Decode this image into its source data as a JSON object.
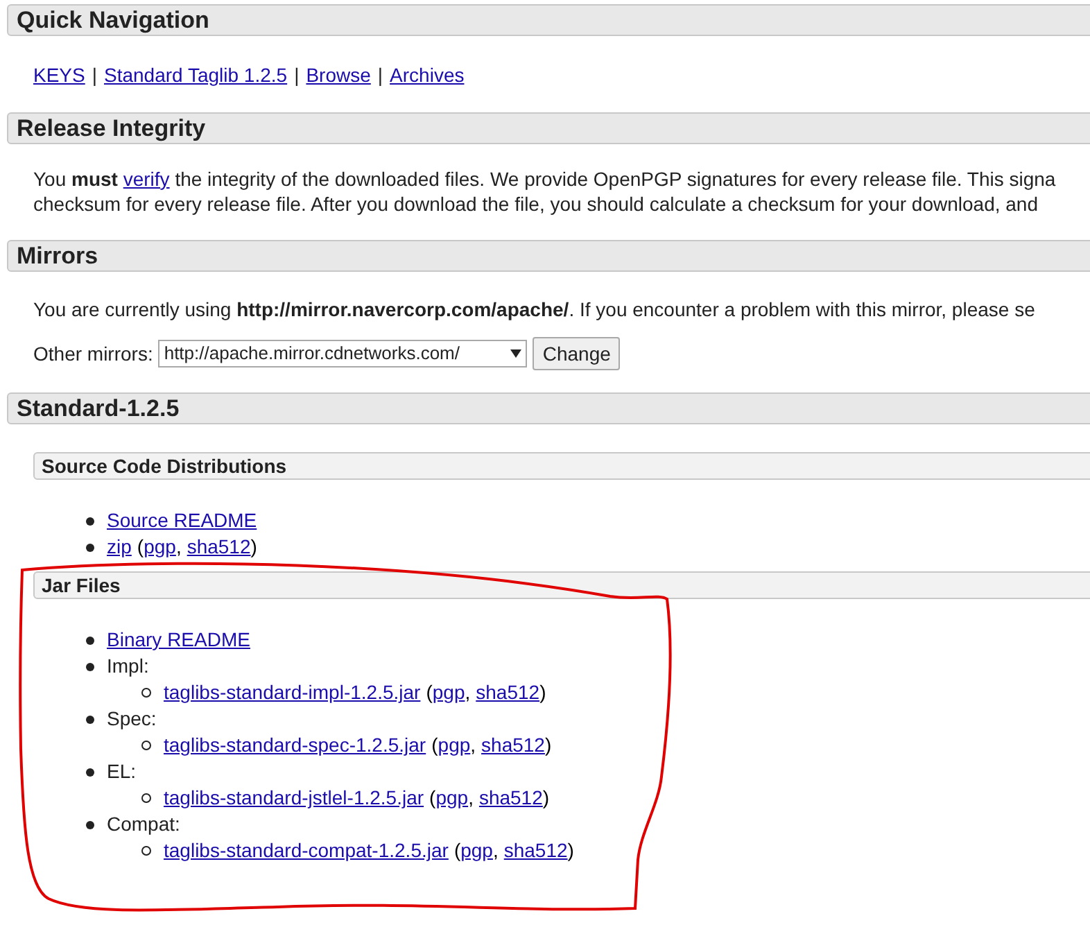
{
  "sections": [
    {
      "title": "Quick Navigation",
      "kind": "links",
      "separator": "|",
      "links": [
        "KEYS",
        "Standard Taglib 1.2.5",
        "Browse",
        "Archives"
      ]
    },
    {
      "title": "Release Integrity",
      "kind": "paragraph",
      "lines": [
        [
          {
            "kind": "text",
            "text": "You **must** "
          },
          {
            "kind": "link",
            "text": "verify"
          },
          {
            "kind": "text",
            "text": " the integrity of the downloaded files. We provide OpenPGP signatures for every release file. This signa"
          }
        ],
        [
          {
            "kind": "text",
            "text": "checksum for every release file. After you download the file, you should calculate a checksum for your download, and"
          }
        ]
      ]
    },
    {
      "title": "Mirrors",
      "kind": "mirrors",
      "text": "You are currently using **http://mirror.navercorp.com/apache/**. If you encounter a problem with this mirror, please se",
      "select_label": "Other mirrors:",
      "select_value": "http://apache.mirror.cdnetworks.com/",
      "button": "Change"
    },
    {
      "title": "Standard-1.2.5",
      "kind": "downloads",
      "subsections": [
        {
          "title": "Source Code Distributions",
          "items": [
            {
              "kind": "link",
              "text": "Source README"
            },
            {
              "kind": "file",
              "link": "zip",
              "open": "(",
              "pgp": "pgp",
              "comma": ",",
              "sha": "sha512",
              "close": ")"
            }
          ]
        },
        {
          "title": "Jar Files",
          "items": [
            {
              "kind": "link",
              "text": "Binary README"
            },
            {
              "kind": "group",
              "label": "Impl:",
              "children": [
                {
                  "kind": "file",
                  "link": "taglibs-standard-impl-1.2.5.jar",
                  "open": "(",
                  "pgp": "pgp",
                  "comma": ",",
                  "sha": "sha512",
                  "close": ")"
                }
              ]
            },
            {
              "kind": "group",
              "label": "Spec:",
              "children": [
                {
                  "kind": "file",
                  "link": "taglibs-standard-spec-1.2.5.jar",
                  "open": "(",
                  "pgp": "pgp",
                  "comma": ",",
                  "sha": "sha512",
                  "close": ")"
                }
              ]
            },
            {
              "kind": "group",
              "label": "EL:",
              "children": [
                {
                  "kind": "file",
                  "link": "taglibs-standard-jstlel-1.2.5.jar",
                  "open": "(",
                  "pgp": "pgp",
                  "comma": ",",
                  "sha": "sha512",
                  "close": ")"
                }
              ]
            },
            {
              "kind": "group",
              "label": "Compat:",
              "children": [
                {
                  "kind": "file",
                  "link": "taglibs-standard-compat-1.2.5.jar",
                  "open": "(",
                  "pgp": "pgp",
                  "comma": ",",
                  "sha": "sha512",
                  "close": ")"
                }
              ]
            }
          ]
        }
      ]
    }
  ]
}
